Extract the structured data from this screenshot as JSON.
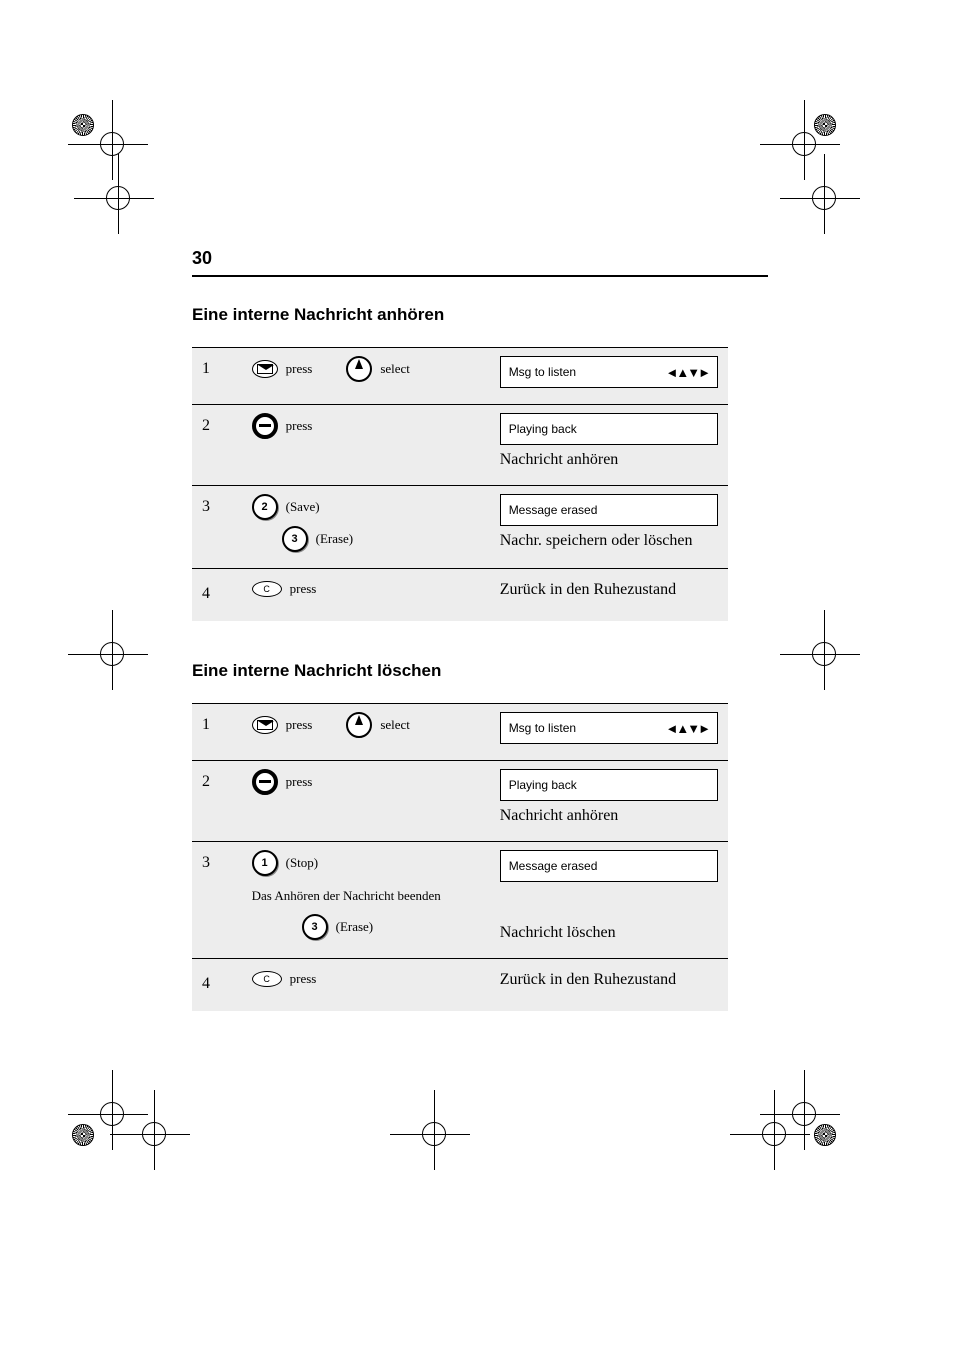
{
  "page_number": "30",
  "section_a": {
    "title": "Eine interne Nachricht anhören",
    "rows": [
      {
        "step": "1",
        "icons": [
          {
            "type": "mail",
            "label": "press"
          },
          {
            "type": "knob",
            "label": "select"
          }
        ],
        "display": "Msg to listen"
      },
      {
        "step": "2",
        "icons": [
          {
            "type": "disc-minus",
            "label": "press"
          }
        ],
        "display": "Playing back",
        "note": "Nachricht anhören"
      },
      {
        "step": "3",
        "icons": [
          {
            "type": "circle",
            "text": "2",
            "label": "(Save)"
          },
          {
            "type": "circle",
            "text": "3",
            "label": "(Erase)",
            "indent": true
          }
        ],
        "display": "Message erased",
        "note": "Nachr. speichern oder löschen"
      },
      {
        "step": "4",
        "icons": [
          {
            "type": "small-oval",
            "text": "C",
            "label": "press"
          }
        ],
        "note": "Zurück in den Ruhezustand"
      }
    ]
  },
  "section_b": {
    "title": "Eine interne Nachricht löschen",
    "rows": [
      {
        "step": "1",
        "icons": [
          {
            "type": "mail",
            "label": "press"
          },
          {
            "type": "knob",
            "label": "select"
          }
        ],
        "display": "Msg to listen"
      },
      {
        "step": "2",
        "icons": [
          {
            "type": "disc-minus",
            "label": "press"
          }
        ],
        "display": "Playing back",
        "note": "Nachricht anhören"
      },
      {
        "step": "3",
        "icons": [
          {
            "type": "circle",
            "text": "1",
            "label": "(Stop)"
          },
          {
            "type": "circle",
            "text": "3",
            "label": "(Erase)",
            "indent": true
          }
        ],
        "display": "Message erased",
        "note2": "Das Anhören der Nachricht beenden",
        "note": "Nachricht löschen"
      },
      {
        "step": "4",
        "icons": [
          {
            "type": "small-oval",
            "text": "C",
            "label": "press"
          }
        ],
        "note": "Zurück in den Ruhezustand"
      }
    ]
  },
  "nav_glyph": "◀▶"
}
